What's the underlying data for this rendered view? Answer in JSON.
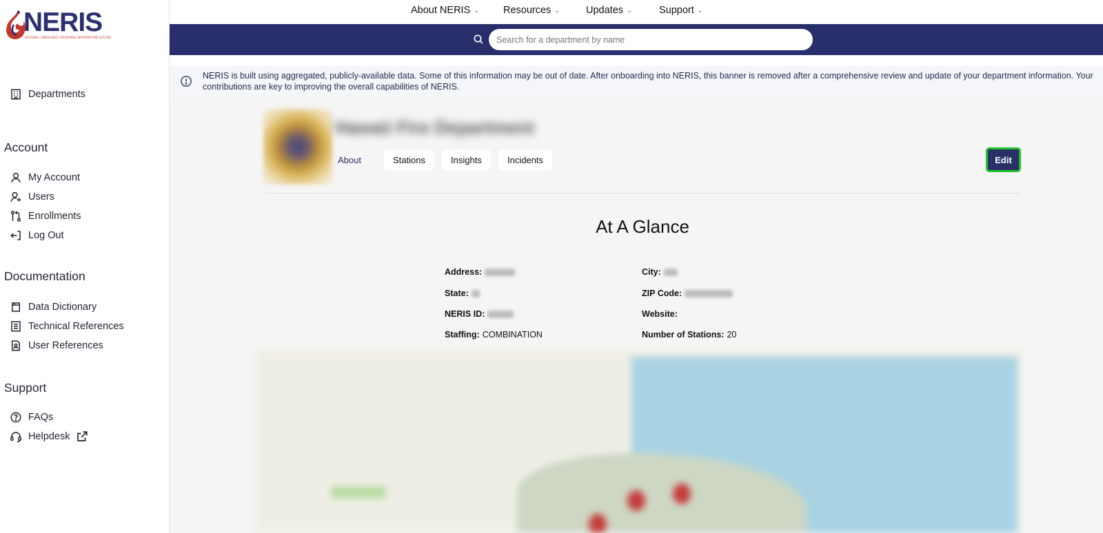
{
  "app": {
    "logo_text": "NERIS",
    "logo_subtitle": "NATIONAL EMERGENCY RESPONSE INFORMATION SYSTEM"
  },
  "sidebar": {
    "top_items": [
      {
        "label": "Departments",
        "icon": "building-icon"
      }
    ],
    "account": {
      "title": "Account",
      "items": [
        {
          "label": "My Account",
          "icon": "user-icon"
        },
        {
          "label": "Users",
          "icon": "user-plus-icon"
        },
        {
          "label": "Enrollments",
          "icon": "git-compare-icon"
        },
        {
          "label": "Log Out",
          "icon": "logout-icon"
        }
      ]
    },
    "documentation": {
      "title": "Documentation",
      "items": [
        {
          "label": "Data Dictionary",
          "icon": "book-icon"
        },
        {
          "label": "Technical References",
          "icon": "document-list-icon"
        },
        {
          "label": "User References",
          "icon": "user-document-icon"
        }
      ]
    },
    "support": {
      "title": "Support",
      "items": [
        {
          "label": "FAQs",
          "icon": "question-circle-icon"
        },
        {
          "label": "Helpdesk",
          "icon": "headset-icon",
          "external": true
        }
      ]
    }
  },
  "topnav": {
    "items": [
      {
        "label": "About NERIS"
      },
      {
        "label": "Resources"
      },
      {
        "label": "Updates"
      },
      {
        "label": "Support"
      }
    ]
  },
  "search": {
    "placeholder": "Search for a department by name"
  },
  "banner": {
    "text": "NERIS is built using aggregated, publicly-available data. Some of this information may be out of date. After onboarding into NERIS, this banner is removed after a comprehensive review and update of your department information. Your contributions are key to improving the overall capabilities of NERIS."
  },
  "department": {
    "name": "Hawaii Fire Department",
    "tabs": [
      {
        "label": "About",
        "active": true
      },
      {
        "label": "Stations"
      },
      {
        "label": "Insights"
      },
      {
        "label": "Incidents"
      }
    ],
    "edit_label": "Edit",
    "section_title": "At A Glance",
    "fields": {
      "address": {
        "label": "Address:"
      },
      "city": {
        "label": "City:"
      },
      "state": {
        "label": "State:"
      },
      "zip": {
        "label": "ZIP Code:"
      },
      "neris_id": {
        "label": "NERIS ID:"
      },
      "website": {
        "label": "Website:",
        "value": ""
      },
      "staffing": {
        "label": "Staffing:",
        "value": "COMBINATION"
      },
      "stations": {
        "label": "Number of Stations:",
        "value": "20"
      }
    }
  },
  "colors": {
    "brand_navy": "#282d6b",
    "edit_focus_ring": "#22c32a",
    "banner_bg": "#f4f6f9",
    "main_bg": "#f5f5f5"
  }
}
